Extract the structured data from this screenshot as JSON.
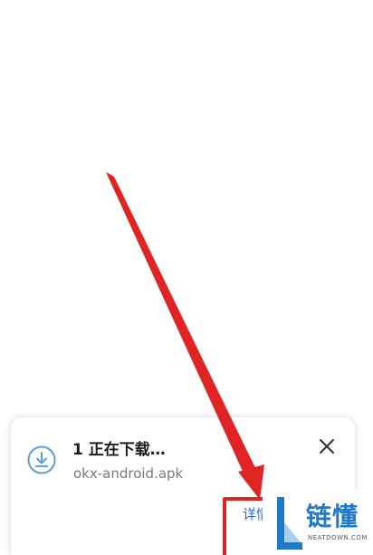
{
  "notification": {
    "title": "1 正在下载…",
    "filename": "okx-android.apk",
    "details_label": "详情",
    "icon": "download-icon",
    "close_icon": "close-icon"
  },
  "watermark": {
    "name": "链懂",
    "sub": "NEATDOWN.COM"
  },
  "colors": {
    "accent": "#2a6ad8",
    "annotation": "#e02424",
    "icon": "#5a9fd8"
  }
}
